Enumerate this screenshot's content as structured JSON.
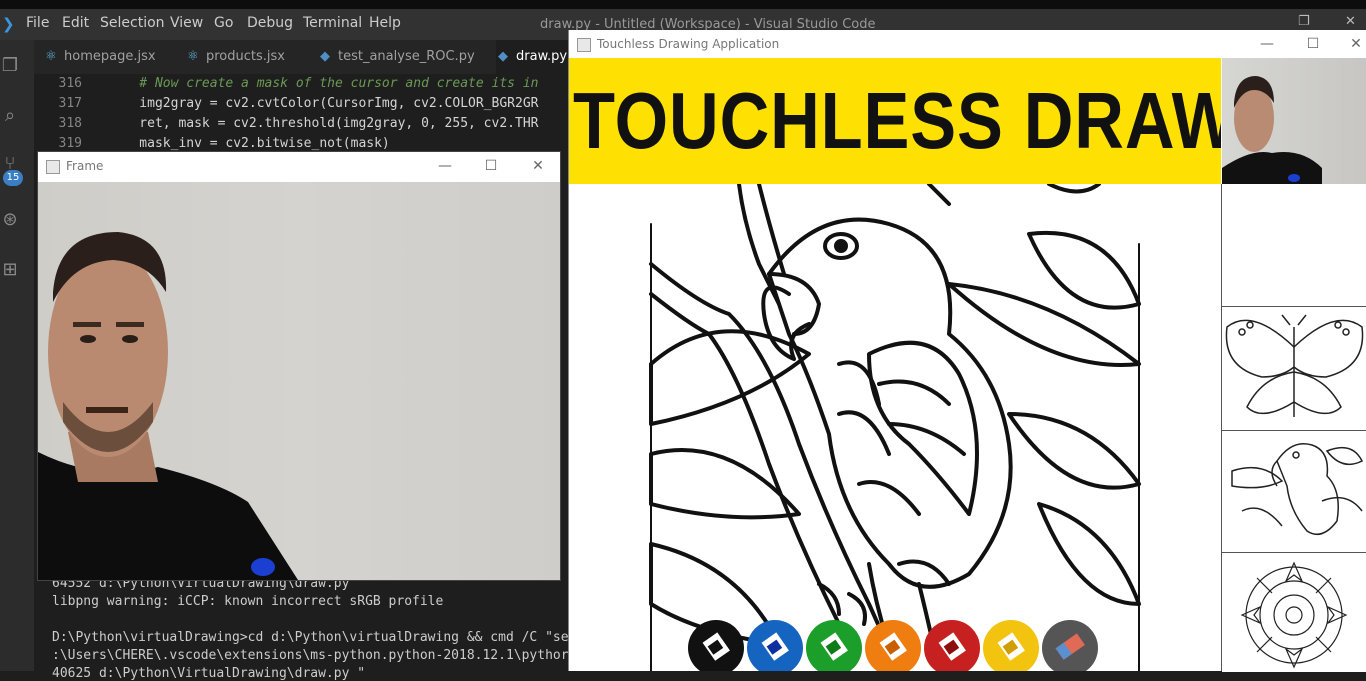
{
  "vscode": {
    "menu": [
      "File",
      "Edit",
      "Selection",
      "View",
      "Go",
      "Debug",
      "Terminal",
      "Help"
    ],
    "title": "draw.py - Untitled (Workspace) - Visual Studio Code",
    "activity_badge": "15",
    "tabs": [
      {
        "label": "homepage.jsx",
        "icon": "react-icon"
      },
      {
        "label": "products.jsx",
        "icon": "react-icon"
      },
      {
        "label": "test_analyse_ROC.py",
        "icon": "python-icon"
      },
      {
        "label": "draw.py",
        "icon": "python-icon"
      }
    ],
    "code_lines": [
      {
        "num": "316",
        "text": "    # Now create a mask of the cursor and create its in",
        "comment": true
      },
      {
        "num": "317",
        "text": "    img2gray = cv2.cvtColor(CursorImg, cv2.COLOR_BGR2GR",
        "comment": false
      },
      {
        "num": "318",
        "text": "    ret, mask = cv2.threshold(img2gray, 0, 255, cv2.THR",
        "comment": false
      },
      {
        "num": "319",
        "text": "    mask_inv = cv2.bitwise_not(mask)",
        "comment": false
      }
    ],
    "terminal_lines": [
      "64552 d:\\Python\\VirtualDrawing\\draw.py \"",
      "libpng warning: iCCP: known incorrect sRGB profile",
      "",
      "D:\\Python\\virtualDrawing>cd d:\\Python\\virtualDrawing && cmd /C \"se",
      ":\\Users\\CHERE\\.vscode\\extensions\\ms-python.python-2018.12.1\\pythor",
      "40625 d:\\Python\\VirtualDrawing\\draw.py \""
    ]
  },
  "frame_window": {
    "title": "Frame",
    "minimize": "—",
    "maximize": "☐",
    "close": "✕"
  },
  "app_window": {
    "title": "Touchless Drawing Application",
    "minimize": "—",
    "maximize": "☐",
    "close": "✕",
    "banner_text": "TOUCHLESS DRAWING",
    "banner_color": "#fee002",
    "palette": [
      {
        "name": "black",
        "color": "#111111"
      },
      {
        "name": "blue",
        "color": "#1565c0"
      },
      {
        "name": "green",
        "color": "#1b9e2a"
      },
      {
        "name": "orange",
        "color": "#ef7d10"
      },
      {
        "name": "red",
        "color": "#c62020"
      },
      {
        "name": "yellow",
        "color": "#f2c40f"
      },
      {
        "name": "eraser",
        "color": "#555555"
      }
    ],
    "thumbnails": [
      "blank",
      "butterfly",
      "parrot",
      "mandala"
    ]
  }
}
